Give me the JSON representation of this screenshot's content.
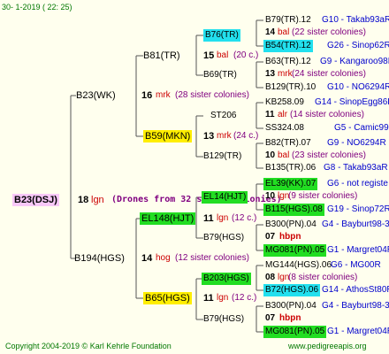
{
  "header": "30-   1-2019  (  22:  25)",
  "root": {
    "id": "B23(DSJ)",
    "num": "18",
    "mark": "lgn",
    "note": "(Drones from 32 sister colonies)"
  },
  "gen1": [
    {
      "id": "B23(WK)",
      "num": "16",
      "mark": "mrk",
      "note": "(28 sister colonies)"
    },
    {
      "id": "B194(HGS)",
      "num": "14",
      "mark": "hog",
      "note": "(12 sister colonies)"
    }
  ],
  "gen2": [
    {
      "id": "B81(TR)",
      "num": "15",
      "mark": "bal",
      "note": "(20 c.)"
    },
    {
      "id": "B59(MKN)",
      "num": "13",
      "mark": "mrk",
      "note": "(24 c.)"
    },
    {
      "id": "EL148(HJT)",
      "num": "11",
      "mark": "lgn",
      "note": "(12 c.)"
    },
    {
      "id": "B65(HGS)",
      "num": "11",
      "mark": "lgn",
      "note": "(12 c.)"
    }
  ],
  "gen3": [
    {
      "id": "B76(TR)"
    },
    {
      "id": "B69(TR)"
    },
    {
      "id": "ST206"
    },
    {
      "id": "B129(TR)"
    },
    {
      "id": "EL14(HJT)"
    },
    {
      "id": "B79(HGS)"
    },
    {
      "id": "B203(HGS)"
    },
    {
      "id": "B79(HGS)"
    }
  ],
  "gen4": [
    {
      "top": "B79(TR).12",
      "topnote": "G10 - Takab93aR",
      "num": "14",
      "mark": "bal",
      "note": "(22 sister colonies)",
      "bottom": "B54(TR).12",
      "bottomnote": "G26 - Sinop62R"
    },
    {
      "top": "B63(TR).12",
      "topnote": "G9 - Kangaroo98R",
      "num": "13",
      "mark": "mrk",
      "note": "(24 sister colonies)",
      "bottom": "B129(TR).10",
      "bottomnote": "G10 - NO6294R"
    },
    {
      "top": "KB258.09",
      "topnote": "G14 - SinopEgg86R",
      "num": "11",
      "mark": "alr",
      "note": "(14 sister colonies)",
      "bottom": "SS324.08",
      "bottomnote": "G5 - Camic99R"
    },
    {
      "top": "B82(TR).07",
      "topnote": "G9 - NO6294R",
      "num": "10",
      "mark": "bal",
      "note": "(23 sister colonies)",
      "bottom": "B135(TR).06",
      "bottomnote": "G8 - Takab93aR"
    },
    {
      "top": "EL39(KK).07",
      "topnote": "G6 - not registe",
      "num": "10",
      "mark": "lgn",
      "note": "(9 sister colonies)",
      "bottom": "B115(HGS).08",
      "bottomnote": "G19 - Sinop72R"
    },
    {
      "top": "B300(PN).04",
      "topnote": "G4 - Bayburt98-3",
      "num": "07",
      "mark": "hbpn",
      "note": "",
      "bottom": "MG081(PN).05",
      "bottomnote": "G1 - Margret04R"
    },
    {
      "top": "MG144(HGS).06",
      "topnote": "G6 - MG00R",
      "num": "08",
      "mark": "lgn",
      "note": "(8 sister colonies)",
      "bottom": "B72(HGS).06",
      "bottomnote": "G14 - AthosSt80R"
    },
    {
      "top": "B300(PN).04",
      "topnote": "G4 - Bayburt98-3",
      "num": "07",
      "mark": "hbpn",
      "note": "",
      "bottom": "MG081(PN).05",
      "bottomnote": "G1 - Margret04R"
    }
  ],
  "footer": {
    "left": "Copyright 2004-2019 © Karl Kehrle Foundation",
    "right": "www.pedigreeapis.org"
  }
}
